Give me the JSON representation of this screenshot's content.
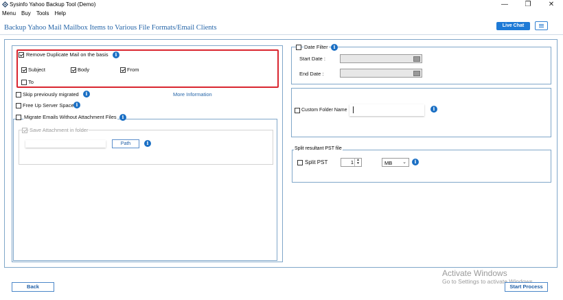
{
  "window": {
    "title": "Sysinfo Yahoo Backup Tool (Demo)",
    "minimize_glyph": "—",
    "restore_glyph": "❐",
    "close_glyph": "✕"
  },
  "menu": [
    "Menu",
    "Buy",
    "Tools",
    "Help"
  ],
  "header": {
    "title": "Backup Yahoo Mail Mailbox Items to Various File Formats/Email Clients",
    "live_chat": "Live Chat"
  },
  "dedupe": {
    "label": "Remove Duplicate Mail on the basis",
    "checked": true,
    "options": {
      "subject": "Subject",
      "body": "Body",
      "from": "From",
      "to": "To"
    }
  },
  "options": {
    "skip_migrated": "Skip previously migrated",
    "more_information": "More Information",
    "free_up": "Free Up Server Space",
    "migrate_without_attachments": "Migrate Emails Without Attachment Files",
    "save_attachment": "Save Attachment in folder",
    "path_button": "Path"
  },
  "date_filter": {
    "label": "Date Filter",
    "start_label": "Start Date :",
    "end_label": "End Date :"
  },
  "custom_folder": {
    "label": "Custom Folder Name"
  },
  "split": {
    "group_title": "Split resultant PST file",
    "label": "Split PST",
    "value": "1",
    "unit": "MB"
  },
  "footer": {
    "back": "Back",
    "start": "Start Process"
  },
  "watermark": {
    "line1": "Activate Windows",
    "line2": "Go to Settings to activate Windows."
  },
  "colors": {
    "accent": "#1e7ad6",
    "title_blue": "#2565a8",
    "highlight_red": "#d9242e",
    "border_blue": "#7fa6c9"
  }
}
